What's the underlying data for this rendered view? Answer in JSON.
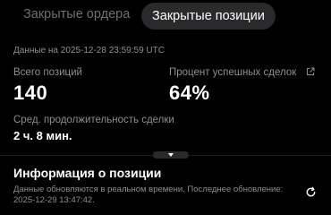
{
  "tabs": [
    {
      "label": "Закрытые ордера",
      "active": false
    },
    {
      "label": "Закрытые позиции",
      "active": true
    }
  ],
  "updated_at": "Данные на 2025-12-28 23:59:59 UTC",
  "stats": {
    "total_positions": {
      "label": "Всего позиций",
      "value": "140"
    },
    "success_rate": {
      "label": "Процент успешных сделок",
      "value": "64%",
      "icon": "external-link-icon"
    },
    "avg_duration": {
      "label": "Сред. продолжительность сделки",
      "value": "2 ч. 8 мин."
    }
  },
  "collapse_icon": "chevron-down-icon",
  "position_info": {
    "title": "Информация о позиции",
    "note": "Данные обновляются в реальном времени. Последнее обновление: 2025-12-29 13:47:42.",
    "refresh_icon": "refresh-icon"
  },
  "colors": {
    "background": "#000000",
    "muted_text": "#8e8e93",
    "active_tab_bg": "#2a2a2c"
  }
}
